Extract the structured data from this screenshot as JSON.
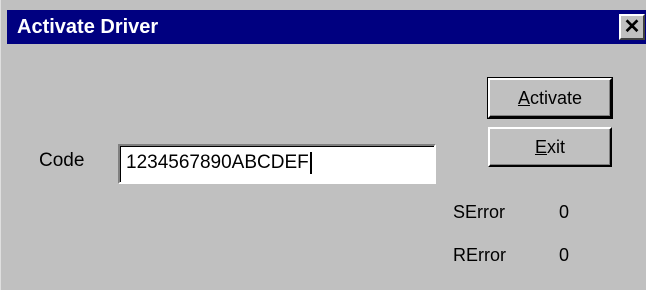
{
  "window": {
    "title": "Activate Driver",
    "close_icon": "close-icon"
  },
  "buttons": {
    "activate_label": "Activate",
    "exit_label": "Exit"
  },
  "form": {
    "code_label": "Code",
    "code_value": "1234567890ABCDEF"
  },
  "status": {
    "serror_label": "SError",
    "serror_value": "0",
    "rerror_label": "RError",
    "rerror_value": "0"
  },
  "colors": {
    "titlebar": "#000080",
    "face": "#c0c0c0"
  }
}
